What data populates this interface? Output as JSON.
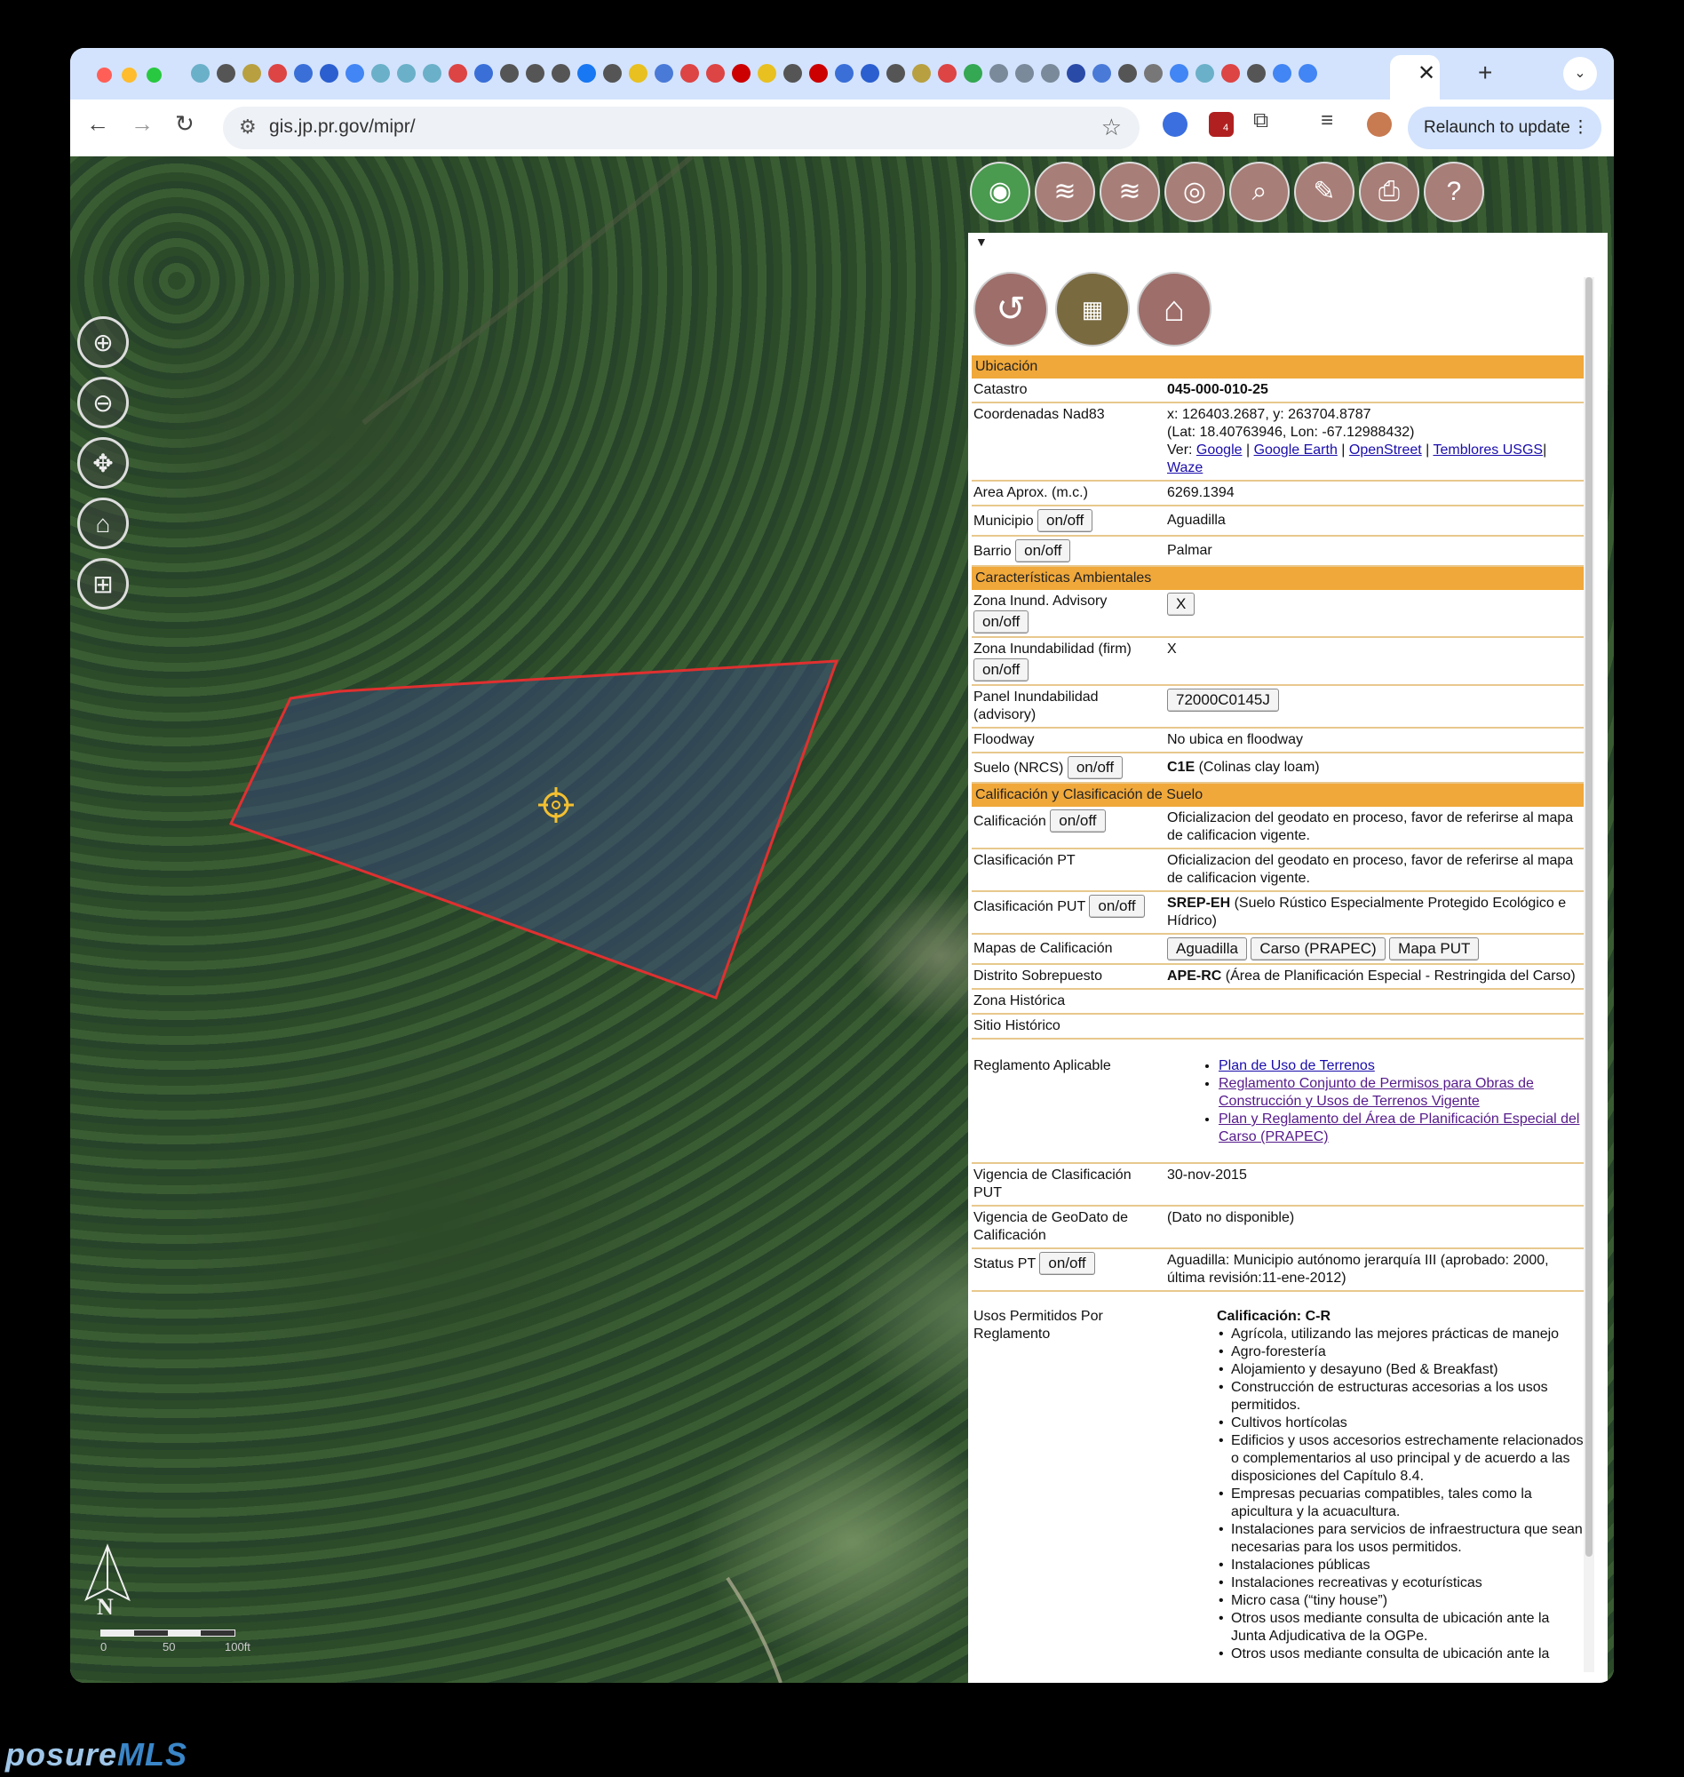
{
  "browser": {
    "url": "gis.jp.pr.gov/mipr/",
    "relaunch_label": "Relaunch to update",
    "ext_badge": "4"
  },
  "map": {
    "north_label": "N",
    "scale_labels": [
      "0",
      "50",
      "100ft"
    ]
  },
  "panel": {
    "sections": {
      "ubicacion": "Ubicación",
      "ambientales": "Características Ambientales",
      "calificacion": "Calificación y Clasificación de Suelo"
    },
    "catastro": {
      "label": "Catastro",
      "value": "045-000-010-25"
    },
    "coords": {
      "label": "Coordenadas Nad83",
      "xy": "x: 126403.2687, y: 263704.8787",
      "latlon": "(Lat: 18.40763946, Lon: -67.12988432)",
      "ver": "Ver:",
      "links": [
        "Google",
        "Google Earth",
        "OpenStreet",
        "Temblores USGS",
        "Waze"
      ]
    },
    "area": {
      "label": "Area Aprox. (m.c.)",
      "value": "6269.1394"
    },
    "municipio": {
      "label": "Municipio",
      "value": "Aguadilla"
    },
    "barrio": {
      "label": "Barrio",
      "value": "Palmar"
    },
    "onoff": "on/off",
    "zona_inund_adv": {
      "label": "Zona Inund. Advisory",
      "value": "X"
    },
    "zona_inund_firm": {
      "label": "Zona Inundabilidad (firm)",
      "value": "X"
    },
    "panel_inund": {
      "label": "Panel Inundabilidad (advisory)",
      "value": "72000C0145J"
    },
    "floodway": {
      "label": "Floodway",
      "value": "No ubica en floodway"
    },
    "suelo": {
      "label": "Suelo (NRCS)",
      "code": "C1E",
      "desc": "(Colinas clay loam)"
    },
    "calificacion": {
      "label": "Calificación",
      "value": "Oficializacion del geodato en proceso, favor de referirse al mapa de calificacion vigente."
    },
    "clasif_pt": {
      "label": "Clasificación PT",
      "value": "Oficializacion del geodato en proceso, favor de referirse al mapa de calificacion vigente."
    },
    "clasif_put": {
      "label": "Clasificación PUT",
      "code": "SREP-EH",
      "desc": "(Suelo Rústico Especialmente Protegido Ecológico e Hídrico)"
    },
    "mapas": {
      "label": "Mapas de Calificación",
      "buttons": [
        "Aguadilla",
        "Carso (PRAPEC)",
        "Mapa PUT"
      ]
    },
    "distrito": {
      "label": "Distrito Sobrepuesto",
      "code": "APE-RC",
      "desc": "(Área de Planificación Especial - Restringida del Carso)"
    },
    "zona_historica": {
      "label": "Zona Histórica"
    },
    "sitio_historico": {
      "label": "Sitio Histórico"
    },
    "reglamento": {
      "label": "Reglamento Aplicable",
      "links": [
        "Plan de Uso de Terrenos",
        "Reglamento Conjunto de Permisos para Obras de Construcción y Usos de Terrenos Vigente",
        "Plan y Reglamento del Área de Planificación Especial del Carso (PRAPEC)"
      ]
    },
    "vig_put": {
      "label": "Vigencia de Clasificación PUT",
      "value": "30-nov-2015"
    },
    "vig_geo": {
      "label": "Vigencia de GeoDato de Calificación",
      "value": "(Dato no disponible)"
    },
    "status_pt": {
      "label": "Status PT",
      "value": "Aguadilla: Municipio autónomo jerarquía III (aprobado: 2000, última revisión:11-ene-2012)"
    },
    "usos": {
      "label": "Usos Permitidos Por Reglamento",
      "heading": "Calificación: C-R",
      "items": [
        "Agrícola, utilizando las mejores prácticas de manejo",
        "Agro-forestería",
        "Alojamiento y desayuno (Bed & Breakfast)",
        "Construcción de estructuras accesorias a los usos permitidos.",
        "Cultivos hortícolas",
        "Edificios y usos accesorios estrechamente relacionados o complementarios al uso principal y de acuerdo a las disposiciones del Capítulo 8.4.",
        "Empresas pecuarias compatibles, tales como la apicultura y la acuacultura.",
        "Instalaciones para servicios de infraestructura que sean necesarias para los usos permitidos.",
        "Instalaciones públicas",
        "Instalaciones recreativas y ecoturísticas",
        "Micro casa (“tiny house”)",
        "Otros usos mediante consulta de ubicación ante la Junta Adjudicativa de la OGPe.",
        "Otros usos mediante consulta de ubicación ante la"
      ]
    }
  },
  "watermark": {
    "a": "posure",
    "b": "MLS"
  },
  "colors": {
    "tabbar": "#d3e3fd",
    "section": "#f0a83a",
    "parcel_outline": "#e03030",
    "parcel_fill": "#3a4a78"
  }
}
